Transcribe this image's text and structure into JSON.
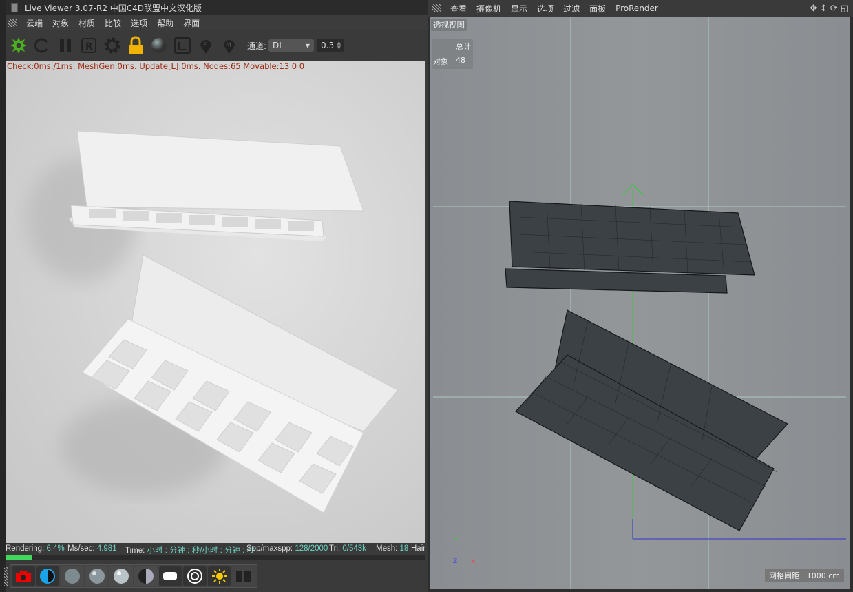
{
  "left": {
    "title": "Live Viewer 3.07-R2 中国C4D联盟中文汉化版",
    "menu": [
      "云端",
      "对象",
      "材质",
      "比较",
      "选项",
      "帮助",
      "界面"
    ],
    "toolbar": {
      "icons": [
        "octane-logo-icon",
        "refresh-icon",
        "pause-icon",
        "r-icon",
        "gear-icon",
        "lock-icon",
        "sphere-icon",
        "region-icon",
        "pin-f-icon",
        "pin-m-icon"
      ],
      "channel_label": "通道:",
      "channel_value": "DL",
      "number_value": "0.3"
    },
    "stats": "Check:0ms./1ms. MeshGen:0ms. Update[L]:0ms. Nodes:65 Movable:13  0 0",
    "status": [
      {
        "label": "Rendering: ",
        "value": "6.4%"
      },
      {
        "label": "Ms/sec: ",
        "value": "4.981"
      },
      {
        "label": "Time: ",
        "value": "小时 : 分钟 : 秒/小时 : 分钟 : 秒"
      },
      {
        "label": "Spp/maxspp: ",
        "value": "128/2000"
      },
      {
        "label": "Tri: ",
        "value": "0/543k"
      },
      {
        "label": "Mesh: ",
        "value": "18"
      },
      {
        "label": "Hair",
        "value": ""
      }
    ],
    "progress_percent": 6.4,
    "bottom_icons": [
      "camera-icon",
      "contrast-icon",
      "diffuse-material-icon",
      "glossy-material-icon",
      "specular-material-icon",
      "mix-material-icon",
      "emission-icon",
      "target-icon",
      "sun-icon",
      "layout-icon"
    ]
  },
  "right": {
    "menu": [
      "查看",
      "摄像机",
      "显示",
      "选项",
      "过滤",
      "面板",
      "ProRender"
    ],
    "view_label": "透视视图",
    "hud": {
      "header": "总计",
      "row_label": "对象",
      "row_value": "48"
    },
    "grid_info": "网格间距 : 1000 cm",
    "axis": {
      "y": "Y",
      "x": "X",
      "z": "Z"
    }
  },
  "colors": {
    "stats_text": "#9b2a10",
    "status_value": "#6fd3c2",
    "progress": "#3fd85a",
    "lock": "#f0b400",
    "octane": "#4caf1f"
  }
}
